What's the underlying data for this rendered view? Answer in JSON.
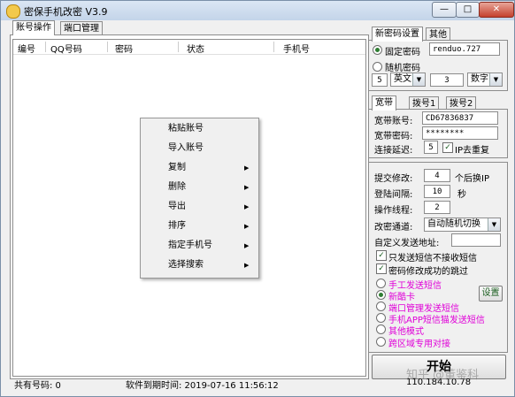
{
  "window": {
    "title": "密保手机改密 V3.9",
    "min": "—",
    "max": "□",
    "close": "✕"
  },
  "tabs": [
    "账号操作",
    "端口管理"
  ],
  "list": {
    "columns": [
      "编号",
      "QQ号码",
      "密码",
      "状态",
      "手机号"
    ]
  },
  "context_menu": [
    {
      "label": "粘贴账号",
      "submenu": false
    },
    {
      "label": "导入账号",
      "submenu": false
    },
    {
      "label": "复制",
      "submenu": true
    },
    {
      "label": "删除",
      "submenu": true
    },
    {
      "label": "导出",
      "submenu": true
    },
    {
      "label": "排序",
      "submenu": true
    },
    {
      "label": "指定手机号",
      "submenu": true
    },
    {
      "label": "选择搜索",
      "submenu": true
    }
  ],
  "password_settings": {
    "tabs": [
      "新密码设置",
      "其他"
    ],
    "fixed_label": "固定密码",
    "fixed_value": "renduo.727",
    "random_label": "随机密码",
    "length": "5",
    "type1": "英文",
    "count": "3",
    "type2": "数字"
  },
  "broadband": {
    "tabs": [
      "宽带",
      "拨号1",
      "拨号2"
    ],
    "account_label": "宽带账号:",
    "account_value": "CD67836837",
    "password_label": "宽带密码:",
    "password_value": "********",
    "delay_label": "连接延迟:",
    "delay_value": "5",
    "ip_dedupe_label": "IP去重复"
  },
  "options": {
    "submit_label": "提交修改:",
    "submit_value": "4",
    "submit_suffix": "个后换IP",
    "login_label": "登陆间隔:",
    "login_value": "10",
    "login_unit": "秒",
    "threads_label": "操作线程:",
    "threads_value": "2",
    "channel_label": "改密通道:",
    "channel_value": "自动随机切换",
    "custom_label": "自定义发送地址:",
    "custom_value": "",
    "check1": "只发送短信不接收短信",
    "check2": "密码修改成功的跳过",
    "radios": [
      "手工发送短信",
      "新酷卡",
      "端口管理发送短信",
      "手机APP短信猫发送短信",
      "其他模式",
      "跨区域专用对接"
    ],
    "settings_button": "设置"
  },
  "start_button": "开始",
  "status": {
    "count": "共有号码: 0",
    "expiry": "软件到期时间: 2019-07-16 11:56:12",
    "ip": "110.184.10.78"
  },
  "watermark": "知乎 @董鉴科"
}
